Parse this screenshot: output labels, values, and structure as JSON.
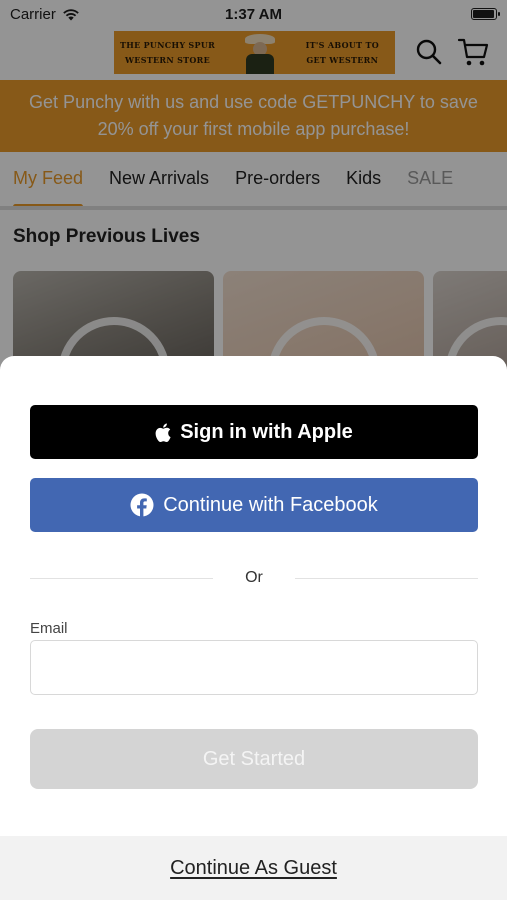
{
  "status_bar": {
    "carrier": "Carrier",
    "time": "1:37 AM"
  },
  "header": {
    "banner_left": "THE PUNCHY SPUR\nWESTERN STORE",
    "banner_left_line1": "THE PUNCHY SPUR",
    "banner_left_line2": "WESTERN STORE",
    "banner_right_line1": "IT'S ABOUT TO",
    "banner_right_line2": "GET WESTERN",
    "icons": [
      "search-icon",
      "cart-icon"
    ]
  },
  "promo": {
    "line1": "Get Punchy with us and use code GETPUNCHY to save",
    "line2": "20% off your first mobile app purchase!"
  },
  "tabs": [
    {
      "label": "My Feed"
    },
    {
      "label": "New Arrivals"
    },
    {
      "label": "Pre-orders"
    },
    {
      "label": "Kids"
    },
    {
      "label": "SALE"
    }
  ],
  "feed": {
    "section_title": "Shop Previous Lives"
  },
  "auth": {
    "apple_label": "Sign in with Apple",
    "facebook_label": "Continue with Facebook",
    "or_label": "Or",
    "email_label": "Email",
    "email_value": "",
    "email_placeholder": "",
    "get_started_label": "Get Started",
    "guest_label": "Continue As Guest"
  },
  "colors": {
    "accent": "#e89a2a",
    "facebook": "#4267b2",
    "apple": "#000000",
    "disabled_button": "#d4d4d4"
  }
}
